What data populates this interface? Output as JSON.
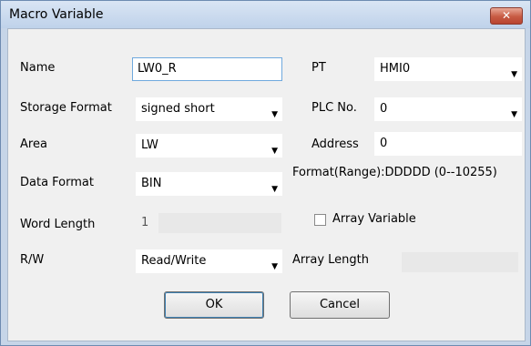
{
  "window": {
    "title": "Macro Variable",
    "close_label": "✕"
  },
  "fields": {
    "name": {
      "label": "Name",
      "value": "LW0_R"
    },
    "storage_format": {
      "label": "Storage Format",
      "value": "signed short"
    },
    "area": {
      "label": "Area",
      "value": "LW"
    },
    "data_format": {
      "label": "Data Format",
      "value": "BIN"
    },
    "word_length": {
      "label": "Word Length",
      "value": "1"
    },
    "rw": {
      "label": "R/W",
      "value": "Read/Write"
    },
    "pt": {
      "label": "PT",
      "value": "HMI0"
    },
    "plc_no": {
      "label": "PLC No.",
      "value": "0"
    },
    "address": {
      "label": "Address",
      "value": "0"
    },
    "format_range": "Format(Range):DDDDD (0--10255)",
    "array_variable": {
      "label": "Array Variable",
      "checked": false
    },
    "array_length": {
      "label": "Array Length",
      "value": ""
    }
  },
  "buttons": {
    "ok": "OK",
    "cancel": "Cancel"
  },
  "icons": {
    "dropdown": "chevron-down-icon"
  }
}
